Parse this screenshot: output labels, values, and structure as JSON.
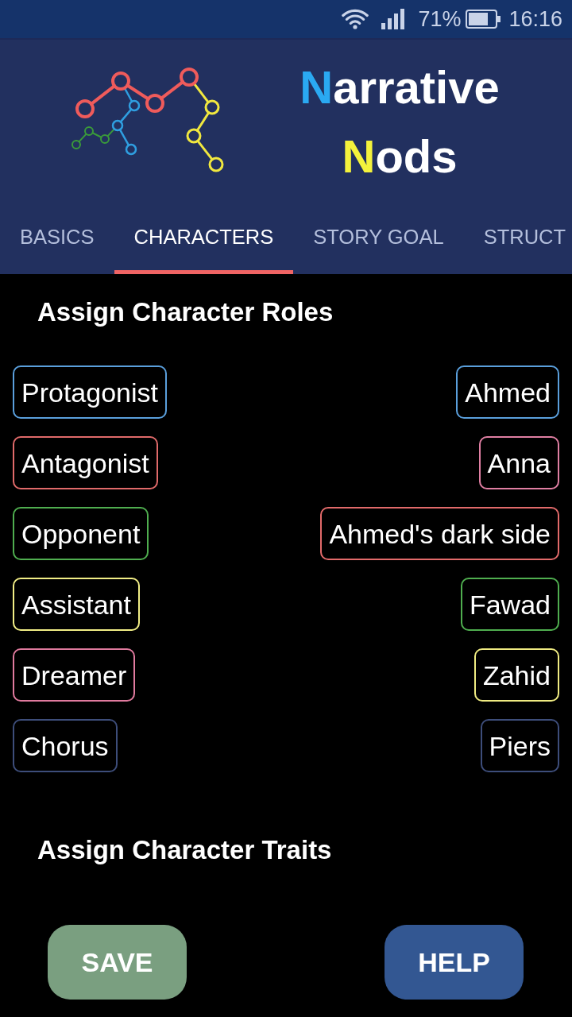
{
  "status_bar": {
    "battery": "71%",
    "time": "16:16"
  },
  "header": {
    "title_lines": [
      {
        "initial": "N",
        "rest": "arrative",
        "color": "#2aa9f2"
      },
      {
        "initial": "N",
        "rest": "ods",
        "color": "#f4f23c"
      }
    ]
  },
  "tabs": [
    {
      "label": "BASICS",
      "selected": false
    },
    {
      "label": "CHARACTERS",
      "selected": true
    },
    {
      "label": "STORY GOAL",
      "selected": false
    },
    {
      "label": "STRUCT",
      "selected": false
    }
  ],
  "roles_section": {
    "heading": "Assign Character Roles",
    "rows": [
      {
        "role": {
          "label": "Protagonist",
          "color": "#5a9fdc"
        },
        "character": {
          "name": "Ahmed",
          "color": "#5a9fdc"
        }
      },
      {
        "role": {
          "label": "Antagonist",
          "color": "#e06a6a"
        },
        "character": {
          "name": "Anna",
          "color": "#e07fa3"
        }
      },
      {
        "role": {
          "label": "Opponent",
          "color": "#4fae4f"
        },
        "character": {
          "name": "Ahmed's dark side",
          "color": "#e26a6a"
        }
      },
      {
        "role": {
          "label": "Assistant",
          "color": "#f2ee86"
        },
        "character": {
          "name": "Fawad",
          "color": "#4fae4f"
        }
      },
      {
        "role": {
          "label": "Dreamer",
          "color": "#e07a9e"
        },
        "character": {
          "name": "Zahid",
          "color": "#f0ec82"
        }
      },
      {
        "role": {
          "label": "Chorus",
          "color": "#3d4d7a"
        },
        "character": {
          "name": "Piers",
          "color": "#3d4d7a"
        }
      }
    ]
  },
  "traits_section": {
    "heading": "Assign Character Traits"
  },
  "buttons": [
    {
      "label": "SAVE",
      "kind": "save"
    },
    {
      "label": "HELP",
      "kind": "help"
    }
  ]
}
